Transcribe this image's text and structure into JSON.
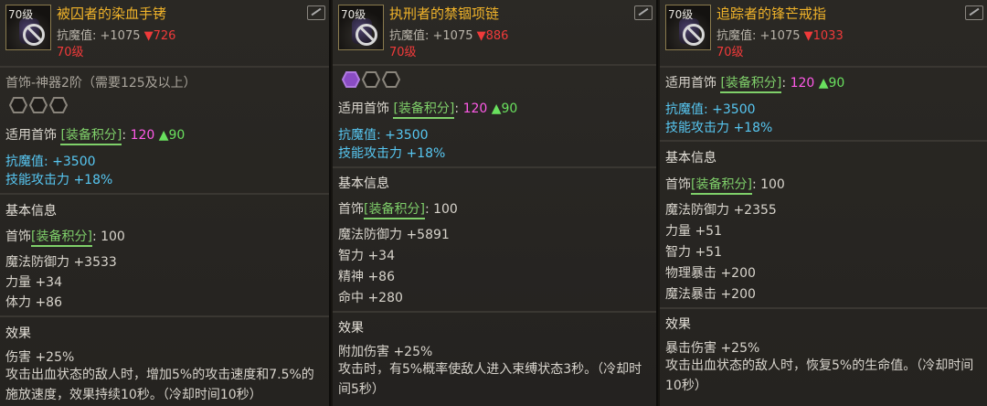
{
  "panels": [
    {
      "level_badge": "70级",
      "title": "被囚者的染血手铐",
      "stat_label": "抗魔值: +1075",
      "stat_down": "▼726",
      "level_text": "70级",
      "category": "首饰-神器2阶（需要125及以上）",
      "slot_label": "适用首饰",
      "tag": "[装备积分]",
      "score": "120",
      "score_up": "▲90",
      "bonus1": "抗魔值: +3500",
      "bonus2": "技能攻击力 +18%",
      "basic_title": "基本信息",
      "basic_type": "首饰",
      "basic_tag": "[装备积分]",
      "basic_score": ": 100",
      "attrs": [
        "魔法防御力 +3533",
        "力量 +34",
        "体力 +86"
      ],
      "effect_title": "效果",
      "effect1": "伤害 +25%",
      "effect_desc": "攻击出血状态的敌人时，增加5%的攻击速度和7.5%的施放速度，效果持续10秒。（冷却时间10秒）"
    },
    {
      "level_badge": "70级",
      "title": "执刑者的禁锢项链",
      "stat_label": "抗魔值: +1075",
      "stat_down": "▼886",
      "level_text": "70级",
      "slot_label": "适用首饰",
      "tag": "[装备积分]",
      "score": "120",
      "score_up": "▲90",
      "bonus1": "抗魔值: +3500",
      "bonus2": "技能攻击力 +18%",
      "basic_title": "基本信息",
      "basic_type": "首饰",
      "basic_tag": "[装备积分]",
      "basic_score": ": 100",
      "attrs": [
        "魔法防御力 +5891",
        "智力 +34",
        "精神 +86",
        "命中 +280"
      ],
      "effect_title": "效果",
      "effect1": "附加伤害 +25%",
      "effect_desc": "攻击时，有5%概率使敌人进入束缚状态3秒。（冷却时间5秒）"
    },
    {
      "level_badge": "70级",
      "title": "追踪者的锋芒戒指",
      "stat_label": "抗魔值: +1075",
      "stat_down": "▼1033",
      "level_text": "70级",
      "slot_label": "适用首饰",
      "tag": "[装备积分]",
      "score": "120",
      "score_up": "▲90",
      "bonus1": "抗魔值: +3500",
      "bonus2": "技能攻击力 +18%",
      "basic_title": "基本信息",
      "basic_type": "首饰",
      "basic_tag": "[装备积分]",
      "basic_score": ": 100",
      "attrs": [
        "魔法防御力 +2355",
        "力量 +51",
        "智力 +51",
        "物理暴击 +200",
        "魔法暴击 +200"
      ],
      "effect_title": "效果",
      "effect1": "暴击伤害 +25%",
      "effect_desc": "攻击出血状态的敌人时，恢复5%的生命值。（冷却时间10秒）"
    }
  ],
  "colors": {
    "title": "#f0b32a",
    "down": "#f03a3a",
    "cyan": "#57c7f2",
    "magenta": "#ff5ae8",
    "green": "#69e05e"
  },
  "icons": [
    "compare-icon",
    "ban-icon",
    "socket-hex-icon"
  ]
}
